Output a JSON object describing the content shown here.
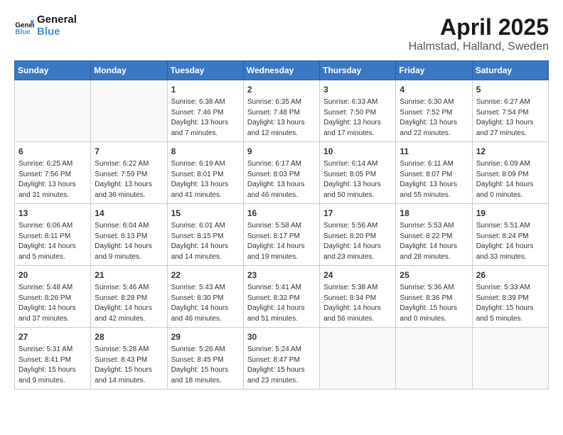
{
  "header": {
    "logo_general": "General",
    "logo_blue": "Blue",
    "month": "April 2025",
    "location": "Halmstad, Halland, Sweden"
  },
  "weekdays": [
    "Sunday",
    "Monday",
    "Tuesday",
    "Wednesday",
    "Thursday",
    "Friday",
    "Saturday"
  ],
  "weeks": [
    [
      {
        "day": "",
        "info": ""
      },
      {
        "day": "",
        "info": ""
      },
      {
        "day": "1",
        "info": "Sunrise: 6:38 AM\nSunset: 7:46 PM\nDaylight: 13 hours and 7 minutes."
      },
      {
        "day": "2",
        "info": "Sunrise: 6:35 AM\nSunset: 7:48 PM\nDaylight: 13 hours and 12 minutes."
      },
      {
        "day": "3",
        "info": "Sunrise: 6:33 AM\nSunset: 7:50 PM\nDaylight: 13 hours and 17 minutes."
      },
      {
        "day": "4",
        "info": "Sunrise: 6:30 AM\nSunset: 7:52 PM\nDaylight: 13 hours and 22 minutes."
      },
      {
        "day": "5",
        "info": "Sunrise: 6:27 AM\nSunset: 7:54 PM\nDaylight: 13 hours and 27 minutes."
      }
    ],
    [
      {
        "day": "6",
        "info": "Sunrise: 6:25 AM\nSunset: 7:56 PM\nDaylight: 13 hours and 31 minutes."
      },
      {
        "day": "7",
        "info": "Sunrise: 6:22 AM\nSunset: 7:59 PM\nDaylight: 13 hours and 36 minutes."
      },
      {
        "day": "8",
        "info": "Sunrise: 6:19 AM\nSunset: 8:01 PM\nDaylight: 13 hours and 41 minutes."
      },
      {
        "day": "9",
        "info": "Sunrise: 6:17 AM\nSunset: 8:03 PM\nDaylight: 13 hours and 46 minutes."
      },
      {
        "day": "10",
        "info": "Sunrise: 6:14 AM\nSunset: 8:05 PM\nDaylight: 13 hours and 50 minutes."
      },
      {
        "day": "11",
        "info": "Sunrise: 6:11 AM\nSunset: 8:07 PM\nDaylight: 13 hours and 55 minutes."
      },
      {
        "day": "12",
        "info": "Sunrise: 6:09 AM\nSunset: 8:09 PM\nDaylight: 14 hours and 0 minutes."
      }
    ],
    [
      {
        "day": "13",
        "info": "Sunrise: 6:06 AM\nSunset: 8:11 PM\nDaylight: 14 hours and 5 minutes."
      },
      {
        "day": "14",
        "info": "Sunrise: 6:04 AM\nSunset: 8:13 PM\nDaylight: 14 hours and 9 minutes."
      },
      {
        "day": "15",
        "info": "Sunrise: 6:01 AM\nSunset: 8:15 PM\nDaylight: 14 hours and 14 minutes."
      },
      {
        "day": "16",
        "info": "Sunrise: 5:58 AM\nSunset: 8:17 PM\nDaylight: 14 hours and 19 minutes."
      },
      {
        "day": "17",
        "info": "Sunrise: 5:56 AM\nSunset: 8:20 PM\nDaylight: 14 hours and 23 minutes."
      },
      {
        "day": "18",
        "info": "Sunrise: 5:53 AM\nSunset: 8:22 PM\nDaylight: 14 hours and 28 minutes."
      },
      {
        "day": "19",
        "info": "Sunrise: 5:51 AM\nSunset: 8:24 PM\nDaylight: 14 hours and 33 minutes."
      }
    ],
    [
      {
        "day": "20",
        "info": "Sunrise: 5:48 AM\nSunset: 8:26 PM\nDaylight: 14 hours and 37 minutes."
      },
      {
        "day": "21",
        "info": "Sunrise: 5:46 AM\nSunset: 8:28 PM\nDaylight: 14 hours and 42 minutes."
      },
      {
        "day": "22",
        "info": "Sunrise: 5:43 AM\nSunset: 8:30 PM\nDaylight: 14 hours and 46 minutes."
      },
      {
        "day": "23",
        "info": "Sunrise: 5:41 AM\nSunset: 8:32 PM\nDaylight: 14 hours and 51 minutes."
      },
      {
        "day": "24",
        "info": "Sunrise: 5:38 AM\nSunset: 8:34 PM\nDaylight: 14 hours and 56 minutes."
      },
      {
        "day": "25",
        "info": "Sunrise: 5:36 AM\nSunset: 8:36 PM\nDaylight: 15 hours and 0 minutes."
      },
      {
        "day": "26",
        "info": "Sunrise: 5:33 AM\nSunset: 8:39 PM\nDaylight: 15 hours and 5 minutes."
      }
    ],
    [
      {
        "day": "27",
        "info": "Sunrise: 5:31 AM\nSunset: 8:41 PM\nDaylight: 15 hours and 9 minutes."
      },
      {
        "day": "28",
        "info": "Sunrise: 5:28 AM\nSunset: 8:43 PM\nDaylight: 15 hours and 14 minutes."
      },
      {
        "day": "29",
        "info": "Sunrise: 5:26 AM\nSunset: 8:45 PM\nDaylight: 15 hours and 18 minutes."
      },
      {
        "day": "30",
        "info": "Sunrise: 5:24 AM\nSunset: 8:47 PM\nDaylight: 15 hours and 23 minutes."
      },
      {
        "day": "",
        "info": ""
      },
      {
        "day": "",
        "info": ""
      },
      {
        "day": "",
        "info": ""
      }
    ]
  ]
}
